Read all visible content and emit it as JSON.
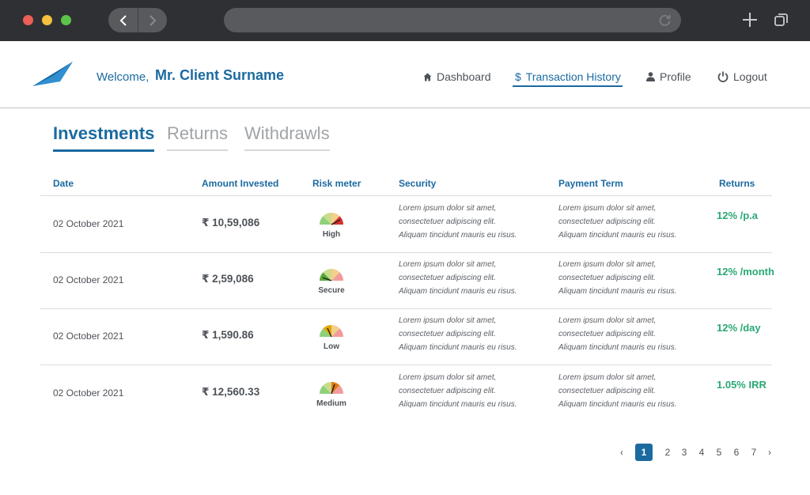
{
  "browser": {
    "back_icon": "chevron-left-icon",
    "forward_icon": "chevron-right-icon",
    "reload_icon": "reload-icon",
    "new_tab_icon": "plus-icon",
    "tabs_icon": "tabs-icon"
  },
  "header": {
    "welcome": "Welcome,",
    "client_name": "Mr. Client Surname",
    "nav": [
      {
        "label": "Dashboard",
        "icon": "home-icon",
        "active": false
      },
      {
        "label": "Transaction History",
        "icon": "dollar-icon",
        "active": true
      },
      {
        "label": "Profile",
        "icon": "user-icon",
        "active": false
      },
      {
        "label": "Logout",
        "icon": "power-icon",
        "active": false
      }
    ]
  },
  "tabs": [
    {
      "label": "Investments",
      "active": true
    },
    {
      "label": "Returns",
      "active": false
    },
    {
      "label": "Withdrawls",
      "active": false
    }
  ],
  "table": {
    "columns": [
      "Date",
      "Amount Invested",
      "Risk meter",
      "Security",
      "Payment Term",
      "Returns"
    ],
    "rows": [
      {
        "date": "02 October 2021",
        "amount": "₹ 10,59,086",
        "risk": "High",
        "security": [
          "Lorem ipsum dolor sit amet,",
          "consectetuer adipiscing elit.",
          "Aliquam tincidunt mauris eu risus."
        ],
        "payment_term": [
          "Lorem ipsum dolor sit amet,",
          "consectetuer adipiscing elit.",
          "Aliquam tincidunt mauris eu risus."
        ],
        "returns": "12% /p.a"
      },
      {
        "date": "02 October 2021",
        "amount": "₹ 2,59,086",
        "risk": "Secure",
        "security": [
          "Lorem ipsum dolor sit amet,",
          "consectetuer adipiscing elit.",
          "Aliquam tincidunt mauris eu risus."
        ],
        "payment_term": [
          "Lorem ipsum dolor sit amet,",
          "consectetuer adipiscing elit.",
          "Aliquam tincidunt mauris eu risus."
        ],
        "returns": "12% /month"
      },
      {
        "date": "02 October 2021",
        "amount": "₹ 1,590.86",
        "risk": "Low",
        "security": [
          "Lorem ipsum dolor sit amet,",
          "consectetuer adipiscing elit.",
          "Aliquam tincidunt mauris eu risus."
        ],
        "payment_term": [
          "Lorem ipsum dolor sit amet,",
          "consectetuer adipiscing elit.",
          "Aliquam tincidunt mauris eu risus."
        ],
        "returns": "12% /day"
      },
      {
        "date": "02 October 2021",
        "amount": "₹ 12,560.33",
        "risk": "Medium",
        "security": [
          "Lorem ipsum dolor sit amet,",
          "consectetuer adipiscing elit.",
          "Aliquam tincidunt mauris eu risus."
        ],
        "payment_term": [
          "Lorem ipsum dolor sit amet,",
          "consectetuer adipiscing elit.",
          "Aliquam tincidunt mauris eu risus."
        ],
        "returns": "1.05% IRR"
      }
    ]
  },
  "pagination": {
    "prev": "‹",
    "next": "›",
    "pages": [
      "1",
      "2",
      "3",
      "4",
      "5",
      "6",
      "7"
    ],
    "current": "1"
  },
  "colors": {
    "brand": "#1b6aa0",
    "positive": "#2aa876",
    "chrome": "#2f3033",
    "meter_segments": [
      "#8fd07a",
      "#c9dc8b",
      "#f3cf8a",
      "#f2b08a",
      "#f19b9b"
    ],
    "meter_highlights": {
      "High": "#d62f2f",
      "Secure": "#5aaa3a",
      "Low": "#e0a800",
      "Medium": "#e07a10"
    }
  }
}
